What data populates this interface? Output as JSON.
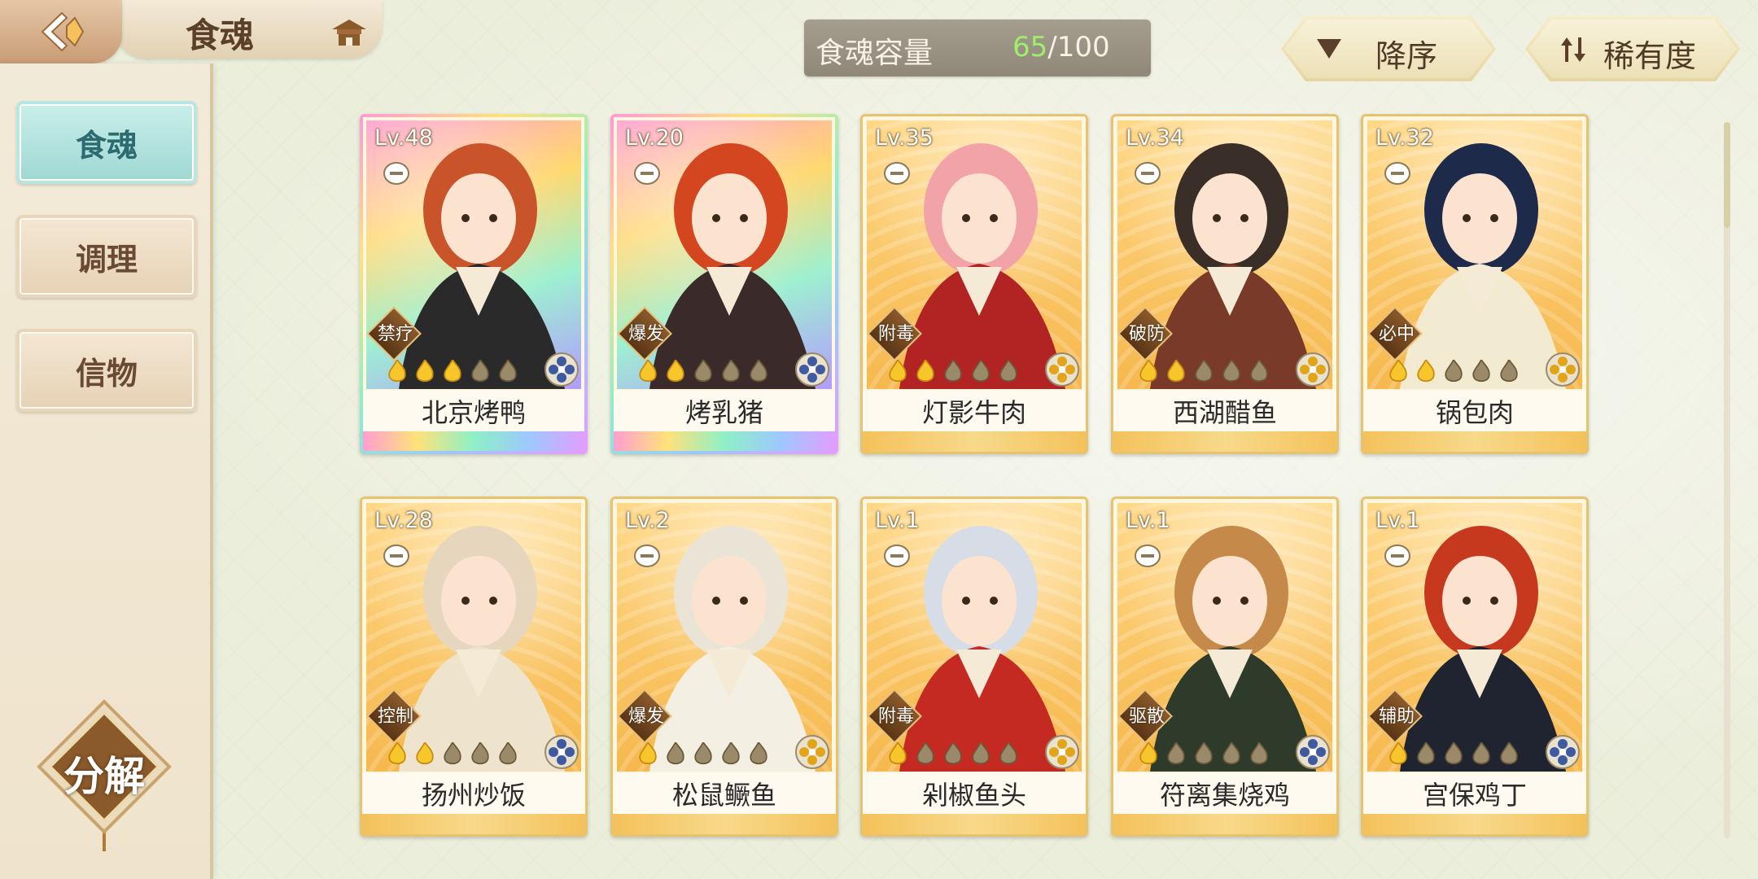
{
  "header": {
    "title": "食魂",
    "back_icon": "back-arrow-icon",
    "house_icon": "pavilion-icon"
  },
  "sidebar": {
    "items": [
      {
        "label": "食魂",
        "active": true
      },
      {
        "label": "调理",
        "active": false
      },
      {
        "label": "信物",
        "active": false
      }
    ],
    "decompose_label": "分解"
  },
  "capacity": {
    "label": "食魂容量",
    "current": "65",
    "max": "/100"
  },
  "sort": {
    "order_label": "降序",
    "rarity_label": "稀有度"
  },
  "colors": {
    "accent_gold": "#e7c370",
    "active_tab": "#9fd8d4",
    "capacity_current": "#9df06a"
  },
  "cards": [
    {
      "level": "Lv.48",
      "role": "禁疗",
      "name": "北京烤鸭",
      "rarity": "rainbow",
      "stars": 3,
      "hair": "#c9542a",
      "coat": "#2a2a2a",
      "element_icon": "blue-flower-icon"
    },
    {
      "level": "Lv.20",
      "role": "爆发",
      "name": "烤乳猪",
      "rarity": "rainbow",
      "stars": 2,
      "hair": "#d3461f",
      "coat": "#3a2a2a",
      "element_icon": "blue-flower-icon"
    },
    {
      "level": "Lv.35",
      "role": "附毒",
      "name": "灯影牛肉",
      "rarity": "gold",
      "stars": 2,
      "hair": "#f2a3a8",
      "coat": "#b22424",
      "element_icon": "yellow-flower-icon"
    },
    {
      "level": "Lv.34",
      "role": "破防",
      "name": "西湖醋鱼",
      "rarity": "gold",
      "stars": 2,
      "hair": "#3a2e28",
      "coat": "#7a3a2a",
      "element_icon": "yellow-flower-icon"
    },
    {
      "level": "Lv.32",
      "role": "必中",
      "name": "锅包肉",
      "rarity": "gold",
      "stars": 2,
      "hair": "#1e2a4a",
      "coat": "#f3ead2",
      "element_icon": "yellow-flower-icon"
    },
    {
      "level": "Lv.28",
      "role": "控制",
      "name": "扬州炒饭",
      "rarity": "gold",
      "stars": 2,
      "hair": "#e6d6bd",
      "coat": "#eee3cd",
      "element_icon": "blue-flower-icon"
    },
    {
      "level": "Lv.2",
      "role": "爆发",
      "name": "松鼠鳜鱼",
      "rarity": "gold",
      "stars": 1,
      "hair": "#e9e4d6",
      "coat": "#f4efe3",
      "element_icon": "yellow-flower-icon"
    },
    {
      "level": "Lv.1",
      "role": "附毒",
      "name": "剁椒鱼头",
      "rarity": "gold",
      "stars": 1,
      "hair": "#d7dde6",
      "coat": "#c42a22",
      "element_icon": "yellow-flower-icon"
    },
    {
      "level": "Lv.1",
      "role": "驱散",
      "name": "符离集烧鸡",
      "rarity": "gold",
      "stars": 1,
      "hair": "#c58a4a",
      "coat": "#2e3a2a",
      "element_icon": "blue-flower-icon"
    },
    {
      "level": "Lv.1",
      "role": "辅助",
      "name": "宫保鸡丁",
      "rarity": "gold",
      "stars": 1,
      "hair": "#c7391f",
      "coat": "#1f2430",
      "element_icon": "blue-flower-icon"
    }
  ]
}
